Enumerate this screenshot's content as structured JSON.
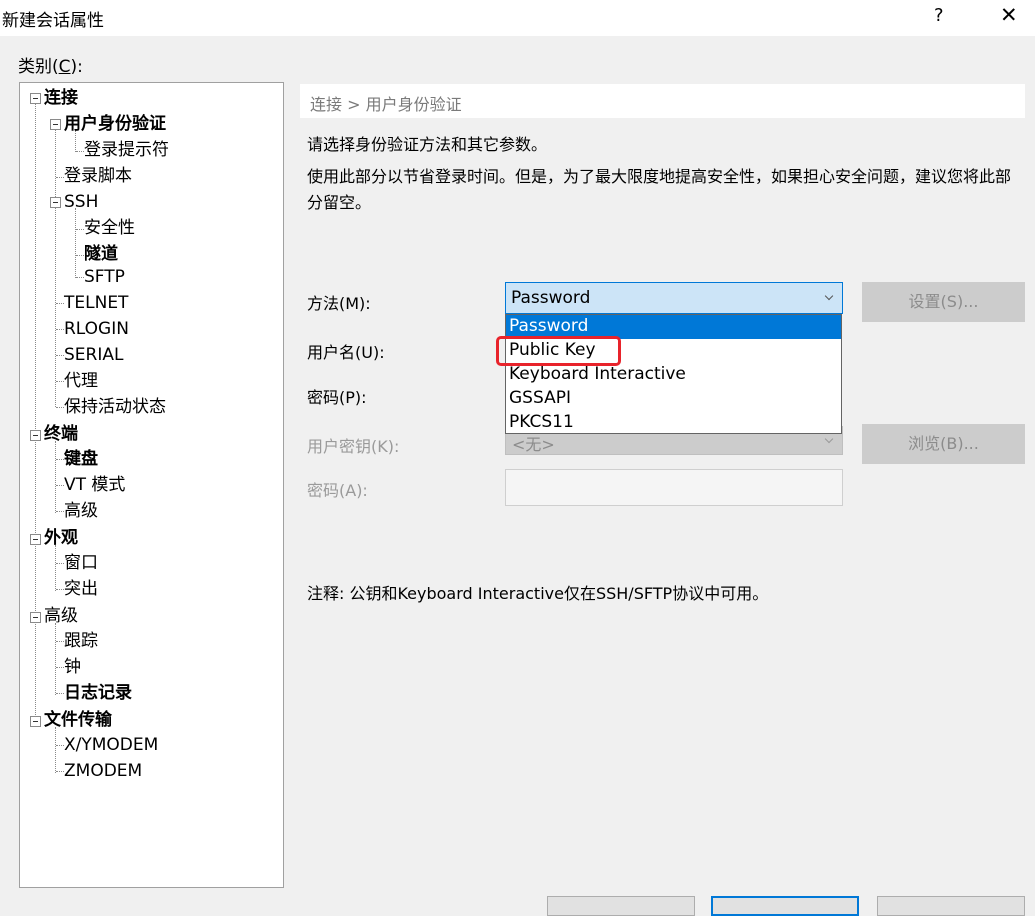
{
  "window": {
    "title": "新建会话属性",
    "help_label": "?",
    "close_label": "✕"
  },
  "category": {
    "label_prefix": "类别(",
    "label_key": "C",
    "label_suffix": "):"
  },
  "tree": [
    {
      "label": "连接",
      "bold": true,
      "level": 0,
      "expander": true
    },
    {
      "label": "用户身份验证",
      "bold": true,
      "level": 1,
      "expander": true
    },
    {
      "label": "登录提示符",
      "bold": false,
      "level": 2
    },
    {
      "label": "登录脚本",
      "bold": false,
      "level": 1
    },
    {
      "label": "SSH",
      "bold": false,
      "level": 1,
      "expander": true
    },
    {
      "label": "安全性",
      "bold": false,
      "level": 2
    },
    {
      "label": "隧道",
      "bold": true,
      "level": 2
    },
    {
      "label": "SFTP",
      "bold": false,
      "level": 2
    },
    {
      "label": "TELNET",
      "bold": false,
      "level": 1
    },
    {
      "label": "RLOGIN",
      "bold": false,
      "level": 1
    },
    {
      "label": "SERIAL",
      "bold": false,
      "level": 1
    },
    {
      "label": "代理",
      "bold": false,
      "level": 1
    },
    {
      "label": "保持活动状态",
      "bold": false,
      "level": 1
    },
    {
      "label": "终端",
      "bold": true,
      "level": 0,
      "expander": true
    },
    {
      "label": "键盘",
      "bold": true,
      "level": 1
    },
    {
      "label": "VT 模式",
      "bold": false,
      "level": 1
    },
    {
      "label": "高级",
      "bold": false,
      "level": 1
    },
    {
      "label": "外观",
      "bold": true,
      "level": 0,
      "expander": true
    },
    {
      "label": "窗口",
      "bold": false,
      "level": 1
    },
    {
      "label": "突出",
      "bold": false,
      "level": 1
    },
    {
      "label": "高级",
      "bold": false,
      "level": 0,
      "expander": true
    },
    {
      "label": "跟踪",
      "bold": false,
      "level": 1
    },
    {
      "label": "钟",
      "bold": false,
      "level": 1
    },
    {
      "label": "日志记录",
      "bold": true,
      "level": 1
    },
    {
      "label": "文件传输",
      "bold": true,
      "level": 0,
      "expander": true
    },
    {
      "label": "X/YMODEM",
      "bold": false,
      "level": 1
    },
    {
      "label": "ZMODEM",
      "bold": false,
      "level": 1
    }
  ],
  "panel": {
    "breadcrumb": "连接 > 用户身份验证",
    "description": "请选择身份验证方法和其它参数。",
    "description2": "使用此部分以节省登录时间。但是，为了最大限度地提高安全性，如果担心安全问题，建议您将此部分留空。",
    "method_label": "方法(M):",
    "username_label": "用户名(U):",
    "password_label": "密码(P):",
    "userkey_label": "用户密钥(K):",
    "passphrase_label": "密码(A):",
    "method_value": "Password",
    "method_options": [
      "Password",
      "Public Key",
      "Keyboard Interactive",
      "GSSAPI",
      "PKCS11"
    ],
    "selected_option_index": 0,
    "userkey_value": "<无>",
    "settings_button": "设置(S)...",
    "browse_button": "浏览(B)...",
    "note": "注释: 公钥和Keyboard Interactive仅在SSH/SFTP协议中可用。"
  },
  "colors": {
    "accent": "#0078d7",
    "highlight_box": "#e8232b",
    "select_bg": "#cce4f7"
  }
}
